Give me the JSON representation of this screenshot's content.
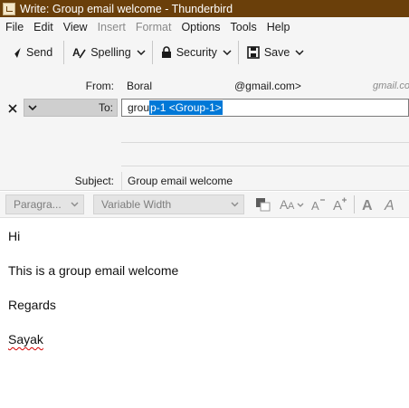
{
  "window": {
    "title": "Write: Group email welcome - Thunderbird"
  },
  "menu": [
    {
      "label": "File",
      "disabled": false
    },
    {
      "label": "Edit",
      "disabled": false
    },
    {
      "label": "View",
      "disabled": false
    },
    {
      "label": "Insert",
      "disabled": true
    },
    {
      "label": "Format",
      "disabled": true
    },
    {
      "label": "Options",
      "disabled": false
    },
    {
      "label": "Tools",
      "disabled": false
    },
    {
      "label": "Help",
      "disabled": false
    }
  ],
  "toolbar": {
    "send_label": "Send",
    "spelling_label": "Spelling",
    "security_label": "Security",
    "save_label": "Save"
  },
  "header": {
    "from_label": "From:",
    "from_name": "Boral",
    "from_email": "@gmail.com>",
    "from_extra": "gmail.co",
    "to_type": "To:",
    "to_typed": "grou",
    "to_suggestion": "p-1 <Group-1>",
    "subject_label": "Subject:",
    "subject_value": "Group email welcome"
  },
  "format_bar": {
    "paragraph_select": "Paragra...",
    "font_select": "Variable Width"
  },
  "body": {
    "lines": [
      "Hi",
      "This is a group email welcome",
      "Regards",
      "Sayak"
    ]
  },
  "colors": {
    "titlebar": "#6a3f0a",
    "selection": "#0078d7",
    "toolbar_bg": "#f5f5f5"
  }
}
